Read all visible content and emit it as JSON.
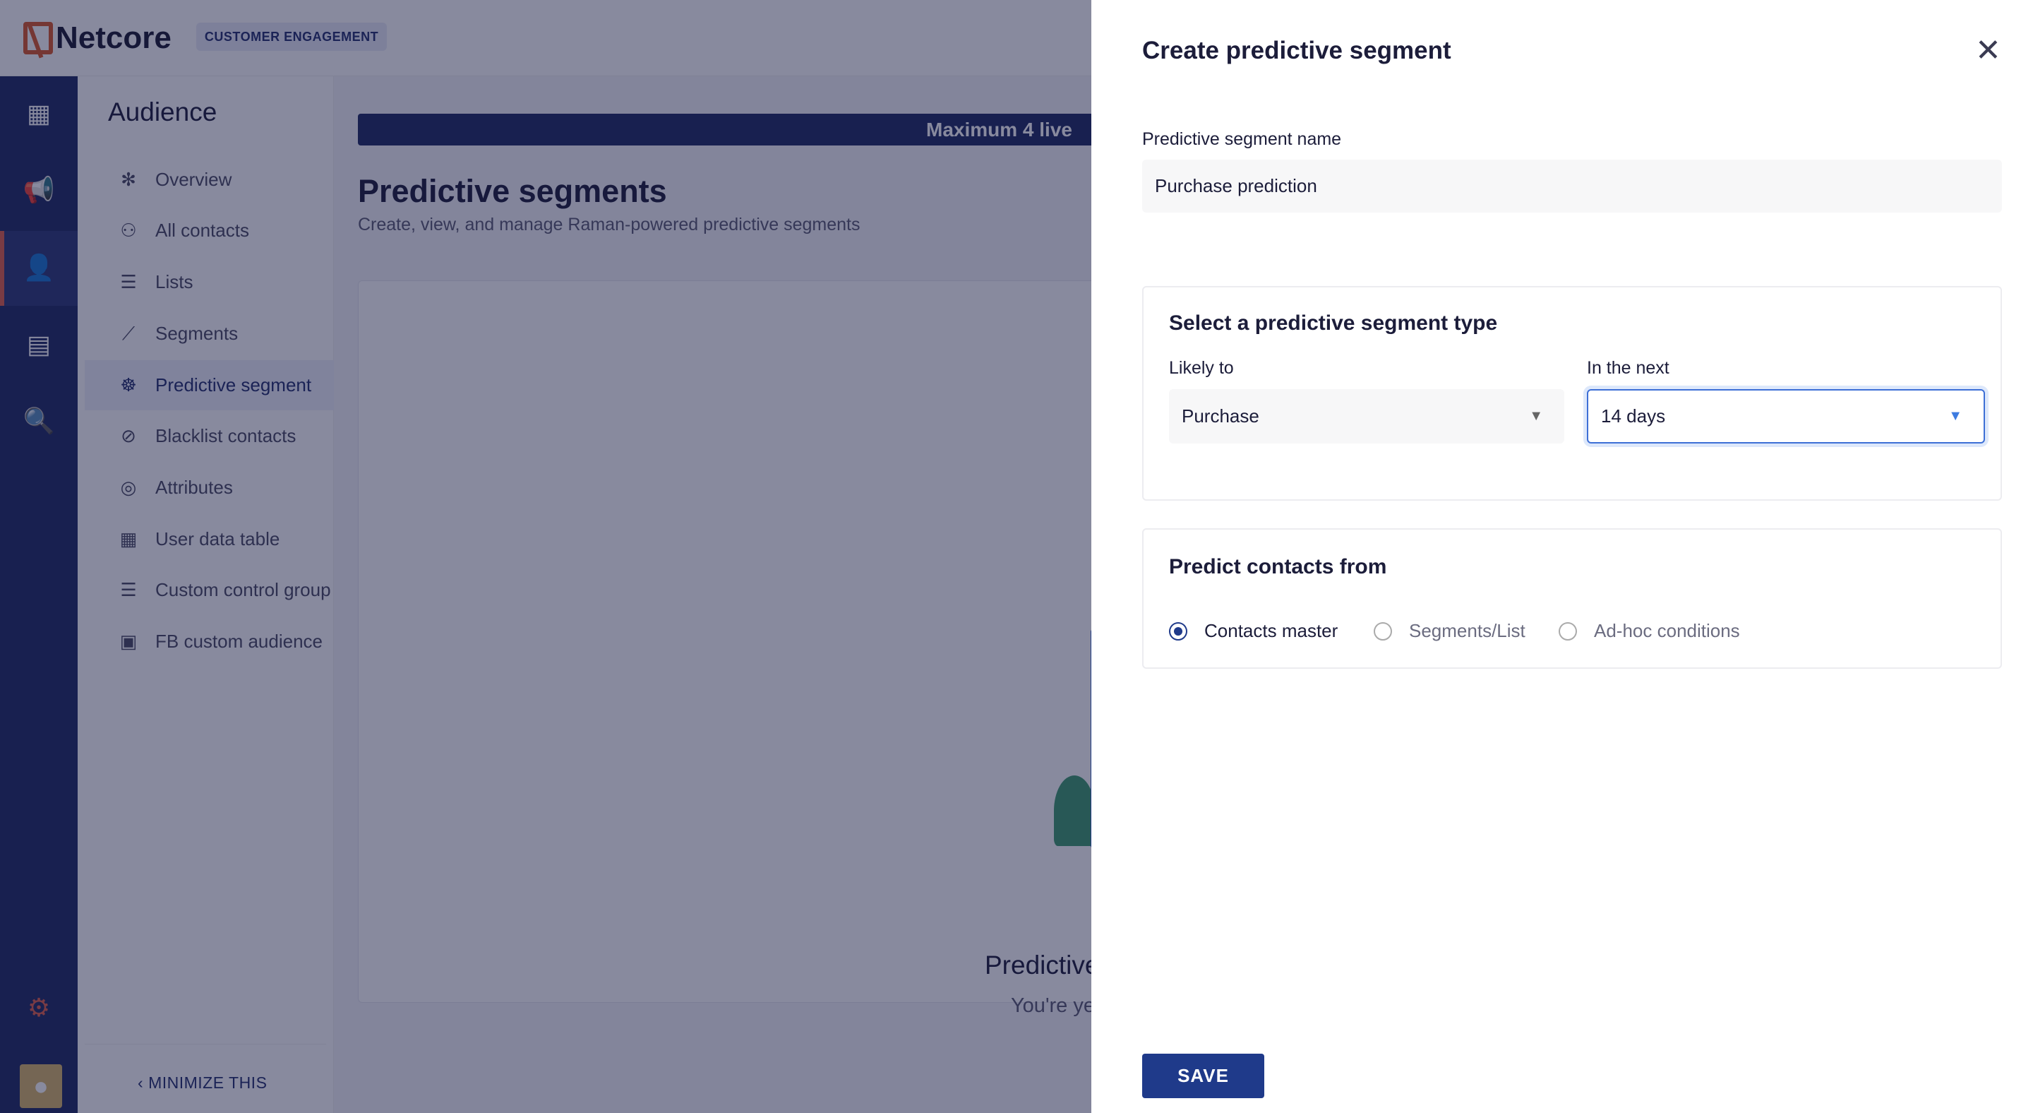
{
  "header": {
    "brand": "Netcore",
    "product_badge": "CUSTOMER ENGAGEMENT"
  },
  "rail": {
    "icons": [
      "dashboard-icon",
      "megaphone-icon",
      "audience-icon",
      "template-icon",
      "analytics-icon",
      "settings-icon",
      "user-avatar-icon"
    ],
    "active": "audience"
  },
  "sidebar": {
    "title": "Audience",
    "items": [
      {
        "label": "Overview",
        "icon": "overview-icon"
      },
      {
        "label": "All contacts",
        "icon": "contacts-icon"
      },
      {
        "label": "Lists",
        "icon": "list-icon"
      },
      {
        "label": "Segments",
        "icon": "segments-icon"
      },
      {
        "label": "Predictive segment",
        "icon": "predictive-icon",
        "active": true
      },
      {
        "label": "Blacklist contacts",
        "icon": "blacklist-icon"
      },
      {
        "label": "Attributes",
        "icon": "attributes-icon"
      },
      {
        "label": "User data table",
        "icon": "table-icon"
      },
      {
        "label": "Custom control group",
        "icon": "list-icon"
      },
      {
        "label": "FB custom audience",
        "icon": "contact-card-icon"
      }
    ],
    "minimize": "MINIMIZE THIS"
  },
  "main": {
    "banner": "Maximum 4 live",
    "title": "Predictive segments",
    "subtitle": "Create, view, and manage Raman-powered predictive segments",
    "empty_title": "Predictive",
    "empty_subtitle": "You're yet"
  },
  "panel": {
    "title": "Create predictive segment",
    "name_label": "Predictive segment name",
    "name_value": "Purchase prediction",
    "type_card": {
      "heading": "Select a predictive segment type",
      "likely_label": "Likely to",
      "likely_value": "Purchase",
      "next_label": "In the next",
      "next_value": "14 days"
    },
    "from_card": {
      "heading": "Predict contacts from",
      "options": [
        {
          "label": "Contacts master",
          "selected": true
        },
        {
          "label": "Segments/List",
          "selected": false
        },
        {
          "label": "Ad-hoc conditions",
          "selected": false
        }
      ]
    },
    "save": "SAVE"
  },
  "colors": {
    "brand_navy": "#1f2a63",
    "accent_orange": "#d9582b",
    "primary_button": "#1f3a8a",
    "focus_blue": "#3d6fd6"
  }
}
